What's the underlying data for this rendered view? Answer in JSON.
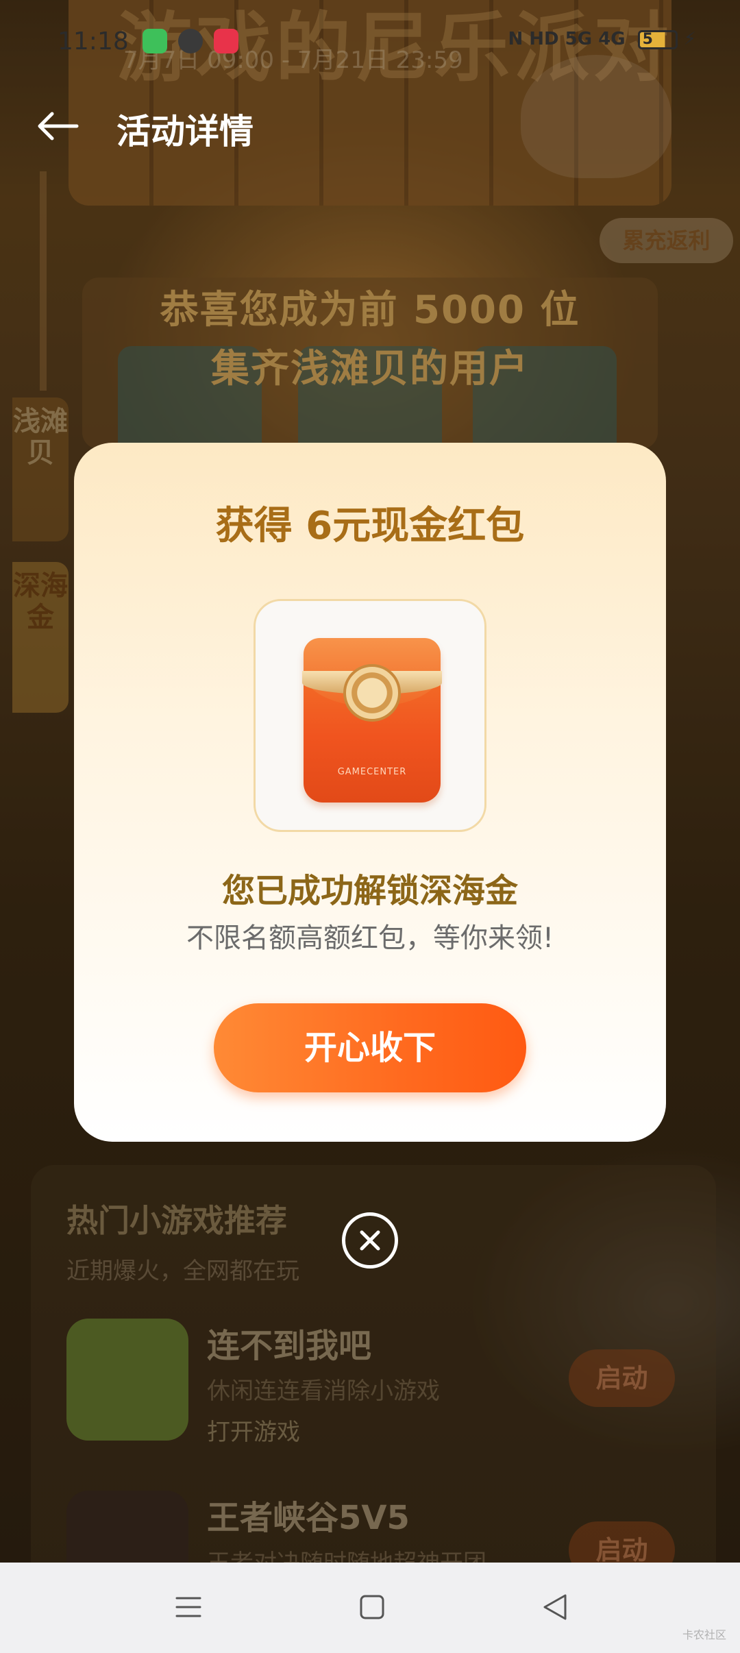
{
  "status_bar": {
    "time": "11:18",
    "right_icons": "N HD 5G 4G",
    "battery": "5"
  },
  "background": {
    "promo_title": "游戏的尼乐派对",
    "promo_date": "7月7日 09:00 - 7月21日 23:59",
    "rebate_tag": "累充返利",
    "side_tab_1": "浅滩贝",
    "side_tab_2": "深海金",
    "congrats_line1": "恭喜您成为前 5000 位",
    "congrats_line2": "集齐浅滩贝的用户"
  },
  "header": {
    "title": "活动详情"
  },
  "modal": {
    "title": "获得 6元现金红包",
    "envelope_label": "GAMECENTER",
    "unlock_text": "您已成功解锁深海金",
    "sub_text": "不限名额高额红包，等你来领!",
    "accept_label": "开心收下"
  },
  "recommend": {
    "title": "热门小游戏推荐",
    "subtitle": "近期爆火，全网都在玩",
    "games": [
      {
        "name": "连不到我吧",
        "desc": "休闲连连看消除小游戏",
        "action": "打开游戏",
        "button": "启动"
      },
      {
        "name": "王者峡谷5V5",
        "desc": "王者对决随时随地超神开团",
        "button": "启动"
      }
    ]
  },
  "watermark": "卡农社区",
  "colors": {
    "accent_orange": "#ff6a1f",
    "title_gold": "#a86d17",
    "congrats_gold": "#f5c26a"
  }
}
